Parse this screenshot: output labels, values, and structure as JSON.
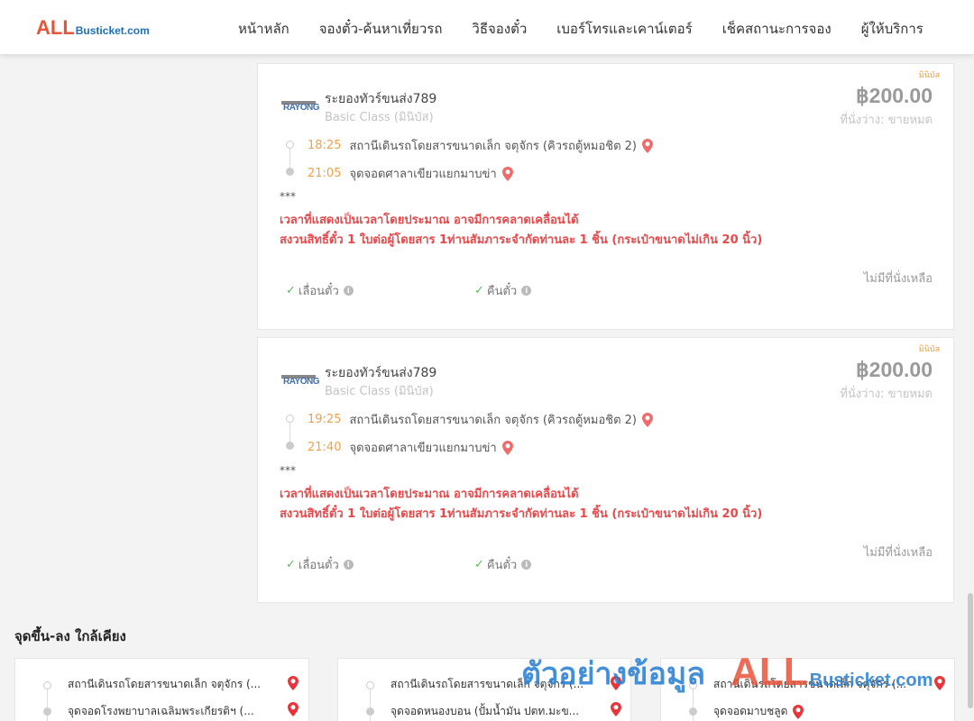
{
  "header": {
    "logo_all": "ALL",
    "logo_rest": "Busticket.com",
    "nav": [
      {
        "label": "หน้าหลัก"
      },
      {
        "label": "จองตั๋ว-ค้นหาเที่ยวรถ"
      },
      {
        "label": "วิธีจองตั๋ว"
      },
      {
        "label": "เบอร์โทรและเคาน์เตอร์"
      },
      {
        "label": "เช็คสถานะการจอง"
      },
      {
        "label": "ผู้ให้บริการ"
      }
    ]
  },
  "trips": [
    {
      "tag": "มินิบัส",
      "operator_logo": "RAYONG",
      "operator": "ระยองทัวร์ขนส่ง789",
      "class": "Basic Class (มินิบัส)",
      "price": "฿200.00",
      "seats": "ที่นั่งว่าง: ขายหมด",
      "depart_time": "18:25",
      "depart_stop": "สถานีเดินรถโดยสารขนาดเล็ก จตุจักร (คิวรถตู้หมอชิต 2)",
      "arrive_time": "21:05",
      "arrive_stop": "จุดจอดศาลาเขียวแยกมาบข่า",
      "stars": "***",
      "note1": "เวลาที่แสดงเป็นเวลาโดยประมาณ อาจมีการคลาดเคลื่อนได้",
      "note2": "สงวนสิทธิ์ตั๋ว 1 ใบต่อผู้โดยสาร 1ท่านสัมภาระจำกัดท่านละ 1 ชิ้น (กระเป๋าขนาดไม่เกิน 20 นิ้ว)",
      "no_seat": "ไม่มีที่นั่งเหลือ",
      "policy1": "เลื่อนตั๋ว",
      "policy2": "คืนตั๋ว"
    },
    {
      "tag": "มินิบัส",
      "operator_logo": "RAYONG",
      "operator": "ระยองทัวร์ขนส่ง789",
      "class": "Basic Class (มินิบัส)",
      "price": "฿200.00",
      "seats": "ที่นั่งว่าง: ขายหมด",
      "depart_time": "19:25",
      "depart_stop": "สถานีเดินรถโดยสารขนาดเล็ก จตุจักร (คิวรถตู้หมอชิต 2)",
      "arrive_time": "21:40",
      "arrive_stop": "จุดจอดศาลาเขียวแยกมาบข่า",
      "stars": "***",
      "note1": "เวลาที่แสดงเป็นเวลาโดยประมาณ อาจมีการคลาดเคลื่อนได้",
      "note2": "สงวนสิทธิ์ตั๋ว 1 ใบต่อผู้โดยสาร 1ท่านสัมภาระจำกัดท่านละ 1 ชิ้น (กระเป๋าขนาดไม่เกิน 20 นิ้ว)",
      "no_seat": "ไม่มีที่นั่งเหลือ",
      "policy1": "เลื่อนตั๋ว",
      "policy2": "คืนตั๋ว"
    }
  ],
  "nearby": {
    "title": "จุดขึ้น-ลง ใกล้เคียง",
    "cards": [
      {
        "from": "สถานีเดินรถโดยสารขนาดเล็ก จตุจักร (...",
        "to": "จุดจอดโรงพยาบาลเฉลิมพระเกียรติฯ (..."
      },
      {
        "from": "สถานีเดินรถโดยสารขนาดเล็ก จตุจักร (...",
        "to": "จุดจอดหนองบอน (ปั้มน้ำมัน ปตท.มะข..."
      },
      {
        "from": "สถานีเดินรถโดยสารขนาดเล็ก จตุจักร (...",
        "to": "จุดจอดมาบชลูด"
      }
    ]
  },
  "watermark": {
    "text": "ตัวอย่างข้อมูล",
    "all": "ALL",
    "rest": "Busticket.com"
  },
  "colors": {
    "accent_orange": "#f0a14a",
    "alert_red": "#e8494b",
    "brand_red": "#e8533b",
    "brand_blue": "#1d6fb8"
  }
}
